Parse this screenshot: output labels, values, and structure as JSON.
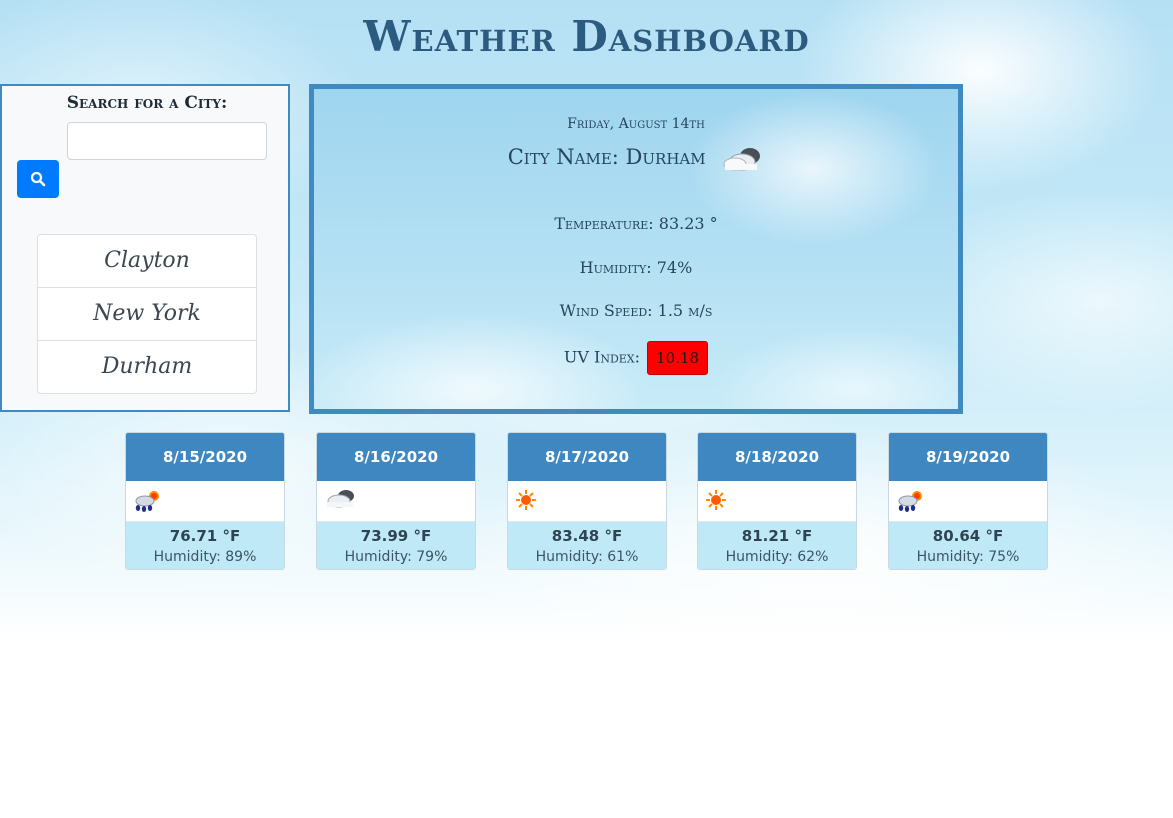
{
  "page": {
    "title": "Weather Dashboard"
  },
  "search": {
    "label": "Search for a City:",
    "input_value": "",
    "input_placeholder": "",
    "button_icon": "search-icon"
  },
  "history": {
    "cities": [
      "Clayton",
      "New York",
      "Durham"
    ]
  },
  "current": {
    "date": "Friday, August 14th",
    "city_line": "City Name: Durham",
    "icon": "cloud-icon",
    "temperature": "Temperature: 83.23 °",
    "humidity": "Humidity: 74%",
    "wind": "Wind Speed: 1.5 m/s",
    "uv_label": "UV Index:",
    "uv_value": "10.18",
    "uv_color": "#ff0000"
  },
  "forecast": [
    {
      "date": "8/15/2020",
      "icon": "rain-sun-icon",
      "temp": "76.71 °F",
      "humidity": "Humidity: 89%"
    },
    {
      "date": "8/16/2020",
      "icon": "cloud-icon",
      "temp": "73.99 °F",
      "humidity": "Humidity: 79%"
    },
    {
      "date": "8/17/2020",
      "icon": "sun-icon",
      "temp": "83.48 °F",
      "humidity": "Humidity: 61%"
    },
    {
      "date": "8/18/2020",
      "icon": "sun-icon",
      "temp": "81.21 °F",
      "humidity": "Humidity: 62%"
    },
    {
      "date": "8/19/2020",
      "icon": "rain-sun-icon",
      "temp": "80.64 °F",
      "humidity": "Humidity: 75%"
    }
  ],
  "colors": {
    "accent": "#3f8ac0",
    "button": "#007bff",
    "forecast_header": "#3e87c0",
    "forecast_body": "#bfe9f6"
  }
}
